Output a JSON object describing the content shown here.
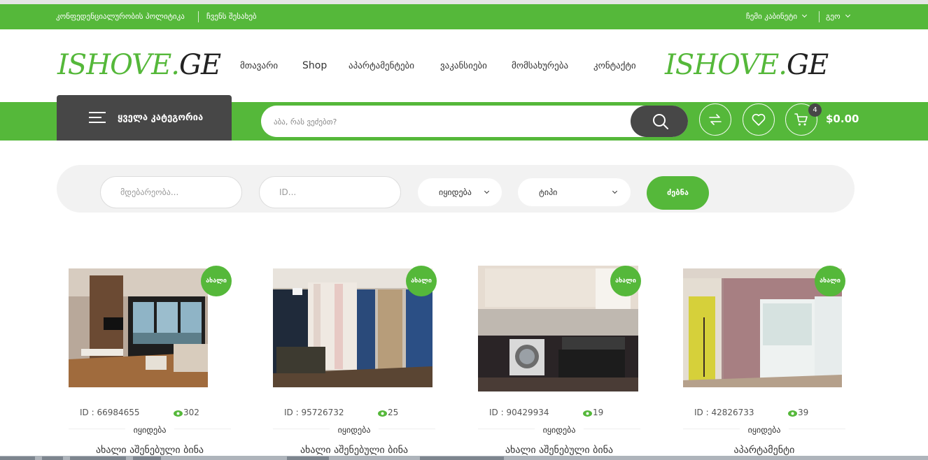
{
  "topbar": {
    "privacy": "კონფედენციალურობის პოლიტიკა",
    "about": "ჩვენს შესახებ",
    "account": "ჩემი კაბინეტი",
    "language": "გეო"
  },
  "logo": {
    "part1": "ISHOVE.",
    "part2": "GE"
  },
  "nav": {
    "items": [
      {
        "label": "მთავარი"
      },
      {
        "label": "Shop"
      },
      {
        "label": "აპარტამენტები"
      },
      {
        "label": "ვაკანსიები"
      },
      {
        "label": "მომსახურება"
      },
      {
        "label": "კონტაქტი"
      }
    ]
  },
  "categories": {
    "label": "ყველა კატეგორია"
  },
  "search": {
    "placeholder": "აბა, რას ვეძებთ?"
  },
  "cart": {
    "count": "4",
    "total": "$0.00"
  },
  "filter": {
    "location_placeholder": "მდებარეობა...",
    "id_placeholder": "ID...",
    "deal_value": "იყიდება",
    "type_value": "ტიპი",
    "submit": "ძებნა"
  },
  "listings": [
    {
      "badge": "ახალი",
      "id_text": "ID : 66984655",
      "views": "302",
      "deal": "იყიდება",
      "title": "ახალი აშენებული ბინა",
      "photo_icon": "modern-living-room-photo"
    },
    {
      "badge": "ახალი",
      "id_text": "ID : 95726732",
      "views": "25",
      "deal": "იყიდება",
      "title": "ახალი აშენებული ბინა",
      "photo_icon": "room-with-curtains-photo"
    },
    {
      "badge": "ახალი",
      "id_text": "ID : 90429934",
      "views": "19",
      "deal": "იყიდება",
      "title": "ახალი აშენებული ბინა",
      "photo_icon": "kitchen-photo"
    },
    {
      "badge": "ახალი",
      "id_text": "ID : 42826733",
      "views": "39",
      "deal": "იყიდება",
      "title": "აპარტამენტი",
      "photo_icon": "pink-room-photo"
    }
  ],
  "colors": {
    "brand_green": "#55b83a",
    "dark_gray": "#474747"
  }
}
